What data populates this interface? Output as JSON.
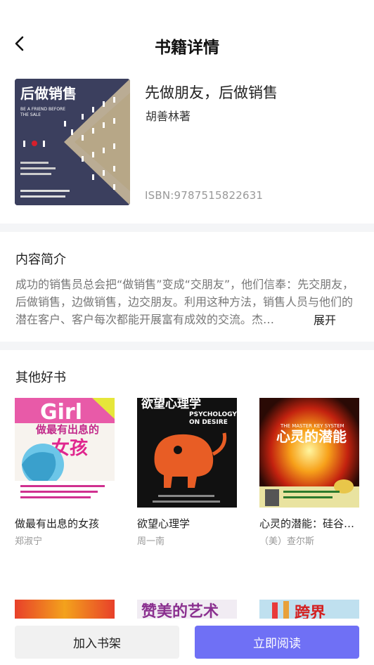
{
  "header": {
    "title": "书籍详情"
  },
  "book": {
    "title": "先做朋友，后做销售",
    "author": "胡善林著",
    "isbn": "ISBN:9787515822631",
    "cover": {
      "headline": "后做销售",
      "subtitle_en_1": "BE A FRIEND BEFORE",
      "subtitle_en_2": "THE SALE"
    }
  },
  "intro": {
    "title": "内容简介",
    "text": "成功的销售员总会把“做销售”变成“交朋友”，他们信奉：先交朋友，后做销售，边做销售，边交朋友。利用这种方法，销售人员与他们的潜在客户、客户每次都能开展富有成效的交流。杰…",
    "expand_label": "展开"
  },
  "others": {
    "title": "其他好书",
    "books": [
      {
        "name": "做最有出息的女孩",
        "author": "郑淑宁",
        "cover_text": "做最有出息的",
        "cover_big": "女孩",
        "cover_top": "Girl"
      },
      {
        "name": "欲望心理学",
        "author": "周一南",
        "cover_text": "欲望心理学",
        "cover_en_1": "PSYCHOLOGY",
        "cover_en_2": "ON DESIRE"
      },
      {
        "name": "心灵的潜能：硅谷…",
        "author": "（美）查尔斯",
        "cover_text": "心灵的潜能",
        "cover_en": "THE MASTER KEY SYSTEM"
      }
    ],
    "row2_covers": [
      "",
      "赞美的艺术",
      "跨界"
    ]
  },
  "actions": {
    "add_shelf": "加入书架",
    "read_now": "立即阅读"
  },
  "colors": {
    "accent": "#6f70f5",
    "divider": "#f4f5f7",
    "muted": "#999999"
  }
}
